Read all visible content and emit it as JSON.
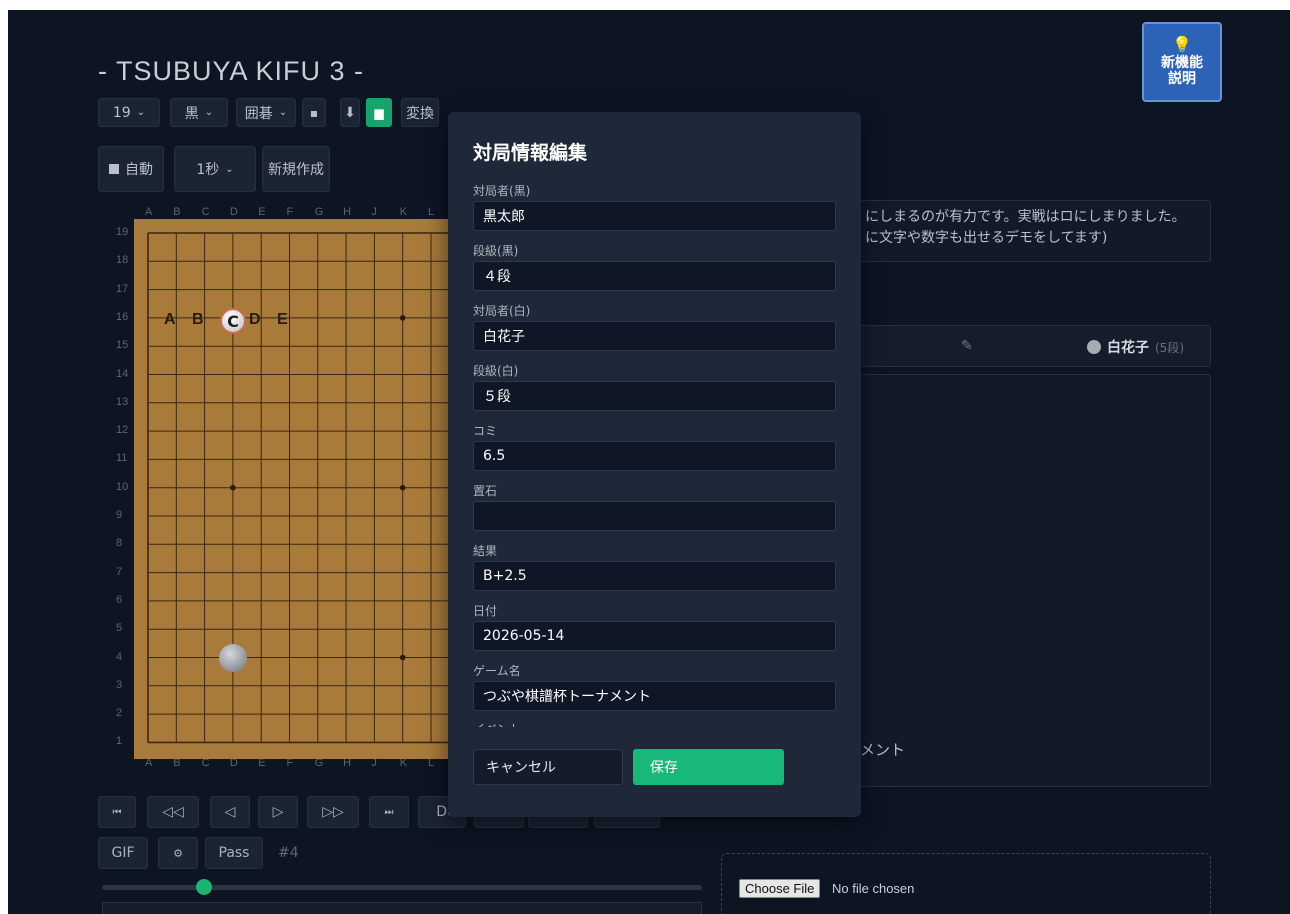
{
  "app": {
    "title": "- TSUBUYA KIFU 3 -",
    "new_feature_button": "新機能説明",
    "new_feature_line1": "新機能",
    "new_feature_line2": "説明"
  },
  "toolbar": {
    "board_size": "19",
    "color": "黒",
    "game": "囲碁",
    "convert": "変換",
    "auto": "自動",
    "interval": "1秒",
    "new": "新規作成"
  },
  "board": {
    "col_labels": [
      "A",
      "B",
      "C",
      "D",
      "E",
      "F",
      "G",
      "H",
      "J",
      "K",
      "L"
    ],
    "row_labels": [
      "19",
      "18",
      "17",
      "16",
      "15",
      "14",
      "13",
      "12",
      "11",
      "10",
      "9",
      "8",
      "7",
      "6",
      "5",
      "4",
      "3",
      "2",
      "1"
    ],
    "marks": [
      "A",
      "B",
      "C",
      "D",
      "E"
    ],
    "stone_label": "C"
  },
  "comment": {
    "line1": "にしまるのが有力です。実戦はロにしまりました。",
    "line2": "に文字や数字も出せるデモをしてます)"
  },
  "players": {
    "white_name": "白花子",
    "white_rank": "(5段)"
  },
  "moves_panel": {
    "comment_label": "メント"
  },
  "navigation": {
    "first": "⏮",
    "prev10": "◁◁",
    "prev": "◁",
    "next": "▷",
    "next10": "▷▷",
    "last": "⏭",
    "de_label": "De",
    "gif": "GIF",
    "settings": "⚙",
    "pass": "Pass",
    "move_count": "#4",
    "slider_fraction": 0.17
  },
  "upload": {
    "choose_file": "Choose File",
    "no_file": "No file chosen"
  },
  "modal": {
    "title": "対局情報編集",
    "fields": [
      {
        "label": "対局者(黒)",
        "value": "黒太郎"
      },
      {
        "label": "段級(黒)",
        "value": "４段"
      },
      {
        "label": "対局者(白)",
        "value": "白花子"
      },
      {
        "label": "段級(白)",
        "value": "５段"
      },
      {
        "label": "コミ",
        "value": "6.5"
      },
      {
        "label": "置石",
        "value": ""
      },
      {
        "label": "結果",
        "value": "B+2.5"
      },
      {
        "label": "日付",
        "value": "2026-05-14"
      },
      {
        "label": "ゲーム名",
        "value": "つぶや棋譜杯トーナメント"
      }
    ],
    "cut_label": "イベント",
    "cancel": "キャンセル",
    "save": "保存"
  },
  "colors": {
    "background": "#0d1422",
    "board": "#a87b3a",
    "accent_green": "#18b87a",
    "feature_blue": "#2c63b6"
  }
}
